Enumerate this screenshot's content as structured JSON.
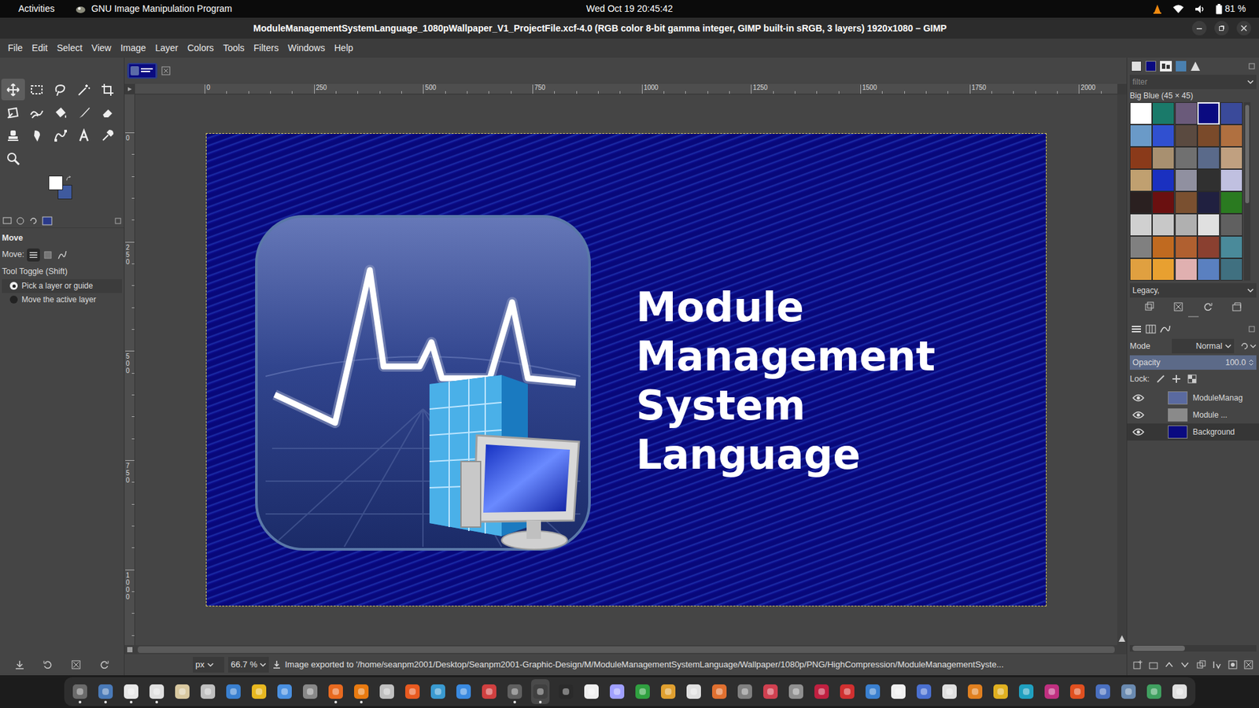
{
  "top_bar": {
    "activities": "Activities",
    "app": "GNU Image Manipulation Program",
    "clock": "Wed Oct 19  20:45:42",
    "battery": "81 %"
  },
  "window": {
    "title": "ModuleManagementSystemLanguage_1080pWallpaper_V1_ProjectFile.xcf-4.0 (RGB color 8-bit gamma integer, GIMP built-in sRGB, 3 layers) 1920x1080 – GIMP"
  },
  "menu": [
    "File",
    "Edit",
    "Select",
    "View",
    "Image",
    "Layer",
    "Colors",
    "Tools",
    "Filters",
    "Windows",
    "Help"
  ],
  "toolbox": {
    "tools": [
      {
        "selected": true
      },
      {
        "selected": false
      },
      {
        "selected": false
      },
      {
        "selected": false
      },
      {
        "selected": false
      },
      {
        "selected": false
      },
      {
        "selected": false
      },
      {
        "selected": false
      },
      {
        "selected": false
      },
      {
        "selected": false
      },
      {
        "selected": false
      },
      {
        "selected": false
      },
      {
        "selected": false
      },
      {
        "selected": false
      },
      {
        "selected": false
      },
      {
        "selected": false
      }
    ],
    "fg_color": "#ffffff",
    "bg_color": "#3f5a9e"
  },
  "tool_options": {
    "title": "Move",
    "move_label": "Move:",
    "modes": [
      {
        "selected": true
      },
      {
        "selected": false
      },
      {
        "selected": false
      }
    ],
    "toggle_label": "Tool Toggle  (Shift)",
    "options": [
      {
        "label": "Pick a layer or guide",
        "selected": true
      },
      {
        "label": "Move the active layer",
        "selected": false
      }
    ]
  },
  "image_tab": {
    "selected": true
  },
  "rulers": {
    "horizontal": [
      "0",
      "250",
      "500",
      "750",
      "1000",
      "1250",
      "1500",
      "1750",
      "2000"
    ],
    "vertical": [
      "0",
      "250",
      "500",
      "750",
      "1000"
    ]
  },
  "canvas": {
    "text_lines": [
      "Module",
      "Management",
      "System",
      "Language"
    ]
  },
  "patterns": {
    "filter_placeholder": "filter",
    "current": "Big Blue (45 × 45)",
    "tag": "Legacy,",
    "items": [
      {
        "color": "#ffffff",
        "selected": false
      },
      {
        "color": "#1a7a6a",
        "selected": false
      },
      {
        "color": "#6a5a7a",
        "selected": false
      },
      {
        "color": "#0a0a80",
        "selected": true
      },
      {
        "color": "#3a4a9a",
        "selected": false
      },
      {
        "color": "#6a9ac8",
        "selected": false
      },
      {
        "color": "#3050d0",
        "selected": false
      },
      {
        "color": "#5a4a40",
        "selected": false
      },
      {
        "color": "#7a4a2a",
        "selected": false
      },
      {
        "color": "#b07040",
        "selected": false
      },
      {
        "color": "#8a3a1a",
        "selected": false
      },
      {
        "color": "#a89070",
        "selected": false
      },
      {
        "color": "#707070",
        "selected": false
      },
      {
        "color": "#5a6a8a",
        "selected": false
      },
      {
        "color": "#c0a080",
        "selected": false
      },
      {
        "color": "#c0a070",
        "selected": false
      },
      {
        "color": "#1a30c0",
        "selected": false
      },
      {
        "color": "#9090a0",
        "selected": false
      },
      {
        "color": "#303030",
        "selected": false
      },
      {
        "color": "#c0c0e0",
        "selected": false
      },
      {
        "color": "#2a2020",
        "selected": false
      },
      {
        "color": "#6a1010",
        "selected": false
      },
      {
        "color": "#7a5030",
        "selected": false
      },
      {
        "color": "#202040",
        "selected": false
      },
      {
        "color": "#2a7a20",
        "selected": false
      },
      {
        "color": "#d0d0d0",
        "selected": false
      },
      {
        "color": "#c8c8c8",
        "selected": false
      },
      {
        "color": "#b0b0b0",
        "selected": false
      },
      {
        "color": "#e0e0e0",
        "selected": false
      },
      {
        "color": "#606060",
        "selected": false
      },
      {
        "color": "#808080",
        "selected": false
      },
      {
        "color": "#c06a20",
        "selected": false
      },
      {
        "color": "#b06030",
        "selected": false
      },
      {
        "color": "#8a4030",
        "selected": false
      },
      {
        "color": "#4a8a9a",
        "selected": false
      },
      {
        "color": "#e0a040",
        "selected": false
      },
      {
        "color": "#e8a030",
        "selected": false
      },
      {
        "color": "#e0b0b0",
        "selected": false
      },
      {
        "color": "#5a80c0",
        "selected": false
      },
      {
        "color": "#407080",
        "selected": false
      }
    ]
  },
  "layers": {
    "mode_label": "Mode",
    "mode": "Normal",
    "opacity_label": "Opacity",
    "opacity": "100.0",
    "lock_label": "Lock:",
    "items": [
      {
        "name": "ModuleManag",
        "visible": true,
        "selected": false,
        "color": "#5a6aa0"
      },
      {
        "name": "Module ...",
        "visible": true,
        "selected": false,
        "color": "#8a8a8a"
      },
      {
        "name": "Background",
        "visible": true,
        "selected": true,
        "color": "#0a0a80"
      }
    ]
  },
  "status_bar": {
    "unit": "px",
    "zoom": "66.7 %",
    "message": "Image exported to '/home/seanpm2001/Desktop/Seanpm2001-Graphic-Design/M/ModuleManagementSystemLanguage/Wallpaper/1080p/PNG/HighCompression/ModuleManagementSyste..."
  },
  "dock": {
    "apps": [
      {
        "color": "#6a6a6a",
        "running": true,
        "selected": false
      },
      {
        "color": "#4a7ab8",
        "running": true,
        "selected": false
      },
      {
        "color": "#e8e8e8",
        "running": true,
        "selected": false
      },
      {
        "color": "#e0e0e0",
        "running": true,
        "selected": false
      },
      {
        "color": "#d8c8a0",
        "running": false,
        "selected": false
      },
      {
        "color": "#c0c0c0",
        "running": false,
        "selected": false
      },
      {
        "color": "#3a80d0",
        "running": false,
        "selected": false
      },
      {
        "color": "#e8b820",
        "running": false,
        "selected": false
      },
      {
        "color": "#4a90e0",
        "running": false,
        "selected": false
      },
      {
        "color": "#888888",
        "running": false,
        "selected": false
      },
      {
        "color": "#e86a20",
        "running": true,
        "selected": false
      },
      {
        "color": "#e87a10",
        "running": true,
        "selected": false
      },
      {
        "color": "#c0c0c0",
        "running": false,
        "selected": false
      },
      {
        "color": "#e85a20",
        "running": false,
        "selected": false
      },
      {
        "color": "#3a9ad0",
        "running": false,
        "selected": false
      },
      {
        "color": "#3a8ae0",
        "running": false,
        "selected": false
      },
      {
        "color": "#d04040",
        "running": false,
        "selected": false
      },
      {
        "color": "#606060",
        "running": true,
        "selected": false
      },
      {
        "color": "#404040",
        "running": true,
        "selected": true
      },
      {
        "color": "#2a2a2a",
        "running": false,
        "selected": false
      },
      {
        "color": "#f0f0f0",
        "running": false,
        "selected": false
      },
      {
        "color": "#a0a0ff",
        "running": false,
        "selected": false
      },
      {
        "color": "#30a040",
        "running": false,
        "selected": false
      },
      {
        "color": "#e0a030",
        "running": false,
        "selected": false
      },
      {
        "color": "#e0e0e0",
        "running": false,
        "selected": false
      },
      {
        "color": "#e07030",
        "running": false,
        "selected": false
      },
      {
        "color": "#808080",
        "running": false,
        "selected": false
      },
      {
        "color": "#d04050",
        "running": false,
        "selected": false
      },
      {
        "color": "#909090",
        "running": false,
        "selected": false
      },
      {
        "color": "#c02040",
        "running": false,
        "selected": false
      },
      {
        "color": "#d03030",
        "running": false,
        "selected": false
      },
      {
        "color": "#3a80d0",
        "running": false,
        "selected": false
      },
      {
        "color": "#f0f0f0",
        "running": false,
        "selected": false
      },
      {
        "color": "#4a70d0",
        "running": false,
        "selected": false
      },
      {
        "color": "#e0e0e0",
        "running": false,
        "selected": false
      },
      {
        "color": "#e08020",
        "running": false,
        "selected": false
      },
      {
        "color": "#e0b020",
        "running": false,
        "selected": false
      },
      {
        "color": "#20a0c0",
        "running": false,
        "selected": false
      },
      {
        "color": "#c03080",
        "running": false,
        "selected": false
      },
      {
        "color": "#e05020",
        "running": false,
        "selected": false
      },
      {
        "color": "#4a70c0",
        "running": false,
        "selected": false
      },
      {
        "color": "#6a8ab0",
        "running": false,
        "selected": false
      },
      {
        "color": "#40a060",
        "running": false,
        "selected": false
      },
      {
        "color": "#e0e0e0",
        "running": false,
        "selected": false
      }
    ]
  }
}
